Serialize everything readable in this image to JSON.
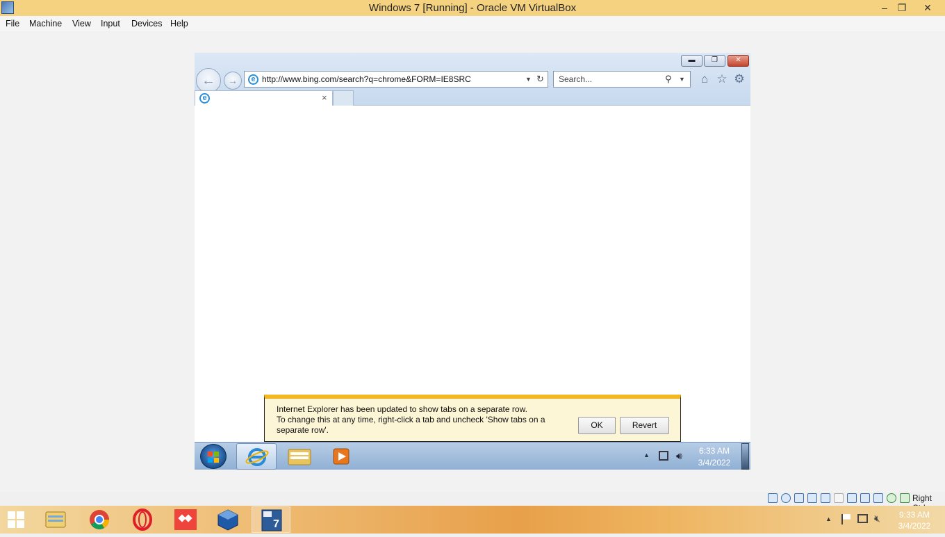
{
  "host": {
    "title": "Windows 7 [Running] - Oracle VM VirtualBox",
    "window_controls": {
      "minimize": "–",
      "restore": "❐",
      "close": "✕"
    },
    "menu": [
      "File",
      "Machine",
      "View",
      "Input",
      "Devices",
      "Help"
    ],
    "status_right_ctrl": "Right Ctrl",
    "taskbar": {
      "pinned_icons": [
        "file-explorer-icon",
        "chrome-icon",
        "opera-icon",
        "anydesk-icon",
        "virtualbox-icon",
        "windows7-vm-icon"
      ],
      "active_icon": "windows7-vm-icon",
      "tray_icons": [
        "chevron-up-icon",
        "flag-icon",
        "network-icon",
        "volume-muted-icon"
      ],
      "time": "9:33 AM",
      "date": "3/4/2022"
    }
  },
  "guest": {
    "ie": {
      "window_controls": {
        "minimize": "▬",
        "restore": "❐",
        "close": "✕"
      },
      "back_glyph": "←",
      "forward_glyph": "→",
      "address": "http://www.bing.com/search?q=chrome&FORM=IE8SRC",
      "address_dropdown": "▼",
      "refresh_glyph": "↻",
      "search_placeholder": "Search...",
      "search_glyph": "⚲",
      "tab_title": "",
      "tab_close": "×",
      "toolbar_icons": {
        "home": "⌂",
        "favorites": "☆",
        "tools": "⚙"
      }
    },
    "notification": {
      "line1": "Internet Explorer has been updated to show tabs on a separate row.",
      "line2": "To change this at any time, right-click a tab and uncheck 'Show tabs on a separate row'.",
      "ok_label": "OK",
      "revert_label": "Revert"
    },
    "taskbar": {
      "pinned_icons": [
        "internet-explorer-icon",
        "windows-explorer-icon",
        "media-player-icon"
      ],
      "active_icon": "internet-explorer-icon",
      "tray_icons": [
        "chevron-up-icon",
        "network-icon",
        "volume-icon"
      ],
      "tray_chevron": "▲",
      "time": "6:33 AM",
      "date": "3/4/2022"
    }
  }
}
